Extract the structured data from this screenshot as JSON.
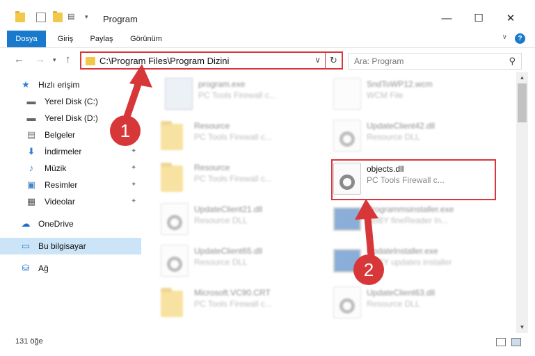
{
  "window": {
    "title": "Program",
    "controls": {
      "minimize": "—",
      "maximize": "☐",
      "close": "✕"
    }
  },
  "ribbon": {
    "tabs": [
      "Dosya",
      "Giriş",
      "Paylaş",
      "Görünüm"
    ],
    "help": "?"
  },
  "address": {
    "path": "C:\\Program Files\\Program Dizini",
    "search_placeholder": "Ara: Program"
  },
  "sidebar": {
    "items": [
      {
        "label": "Hızlı erişim",
        "icon": "star-icon"
      },
      {
        "label": "Yerel Disk (C:)",
        "icon": "drive-icon"
      },
      {
        "label": "Yerel Disk (D:)",
        "icon": "drive-icon"
      },
      {
        "label": "Belgeler",
        "icon": "document-icon"
      },
      {
        "label": "İndirmeler",
        "icon": "download-icon"
      },
      {
        "label": "Müzik",
        "icon": "music-icon"
      },
      {
        "label": "Resimler",
        "icon": "pictures-icon"
      },
      {
        "label": "Videolar",
        "icon": "video-icon"
      },
      {
        "label": "OneDrive",
        "icon": "cloud-icon"
      },
      {
        "label": "Bu bilgisayar",
        "icon": "computer-icon"
      },
      {
        "label": "Ağ",
        "icon": "network-icon"
      }
    ]
  },
  "files": [
    {
      "name": "program.exe",
      "desc": "PC Tools Firewall c...",
      "type": "exe"
    },
    {
      "name": "SndToWP12.wcm",
      "desc": "WCM File",
      "type": "doc"
    },
    {
      "name": "Resource",
      "desc": "PC Tools Firewall c...",
      "type": "folder"
    },
    {
      "name": "UpdateClient42.dll",
      "desc": "Resource DLL",
      "type": "dll"
    },
    {
      "name": "Resource",
      "desc": "PC Tools Firewall c...",
      "type": "folder"
    },
    {
      "name": "objects.dll",
      "desc": "PC Tools Firewall c...",
      "type": "dll"
    },
    {
      "name": "UpdateClient21.dll",
      "desc": "Resource DLL",
      "type": "dll"
    },
    {
      "name": "Programmsinstaller.exe",
      "desc": "ABBY fineReader In...",
      "type": "screen"
    },
    {
      "name": "UpdateClient65.dll",
      "desc": "Resource DLL",
      "type": "dll"
    },
    {
      "name": "UpdateInstaller.exe",
      "desc": "ABBY updates installer",
      "type": "screen"
    },
    {
      "name": "Microsoft.VC90.CRT",
      "desc": "PC Tools Firewall c...",
      "type": "folder"
    },
    {
      "name": "UpdateClient63.dll",
      "desc": "Resource DLL",
      "type": "dll"
    }
  ],
  "status": {
    "count": "131 öğe"
  },
  "annotations": {
    "step1": "1",
    "step2": "2"
  },
  "colors": {
    "accent": "#1979ca",
    "annotation": "#d8373a",
    "selected": "#cce4f7"
  }
}
